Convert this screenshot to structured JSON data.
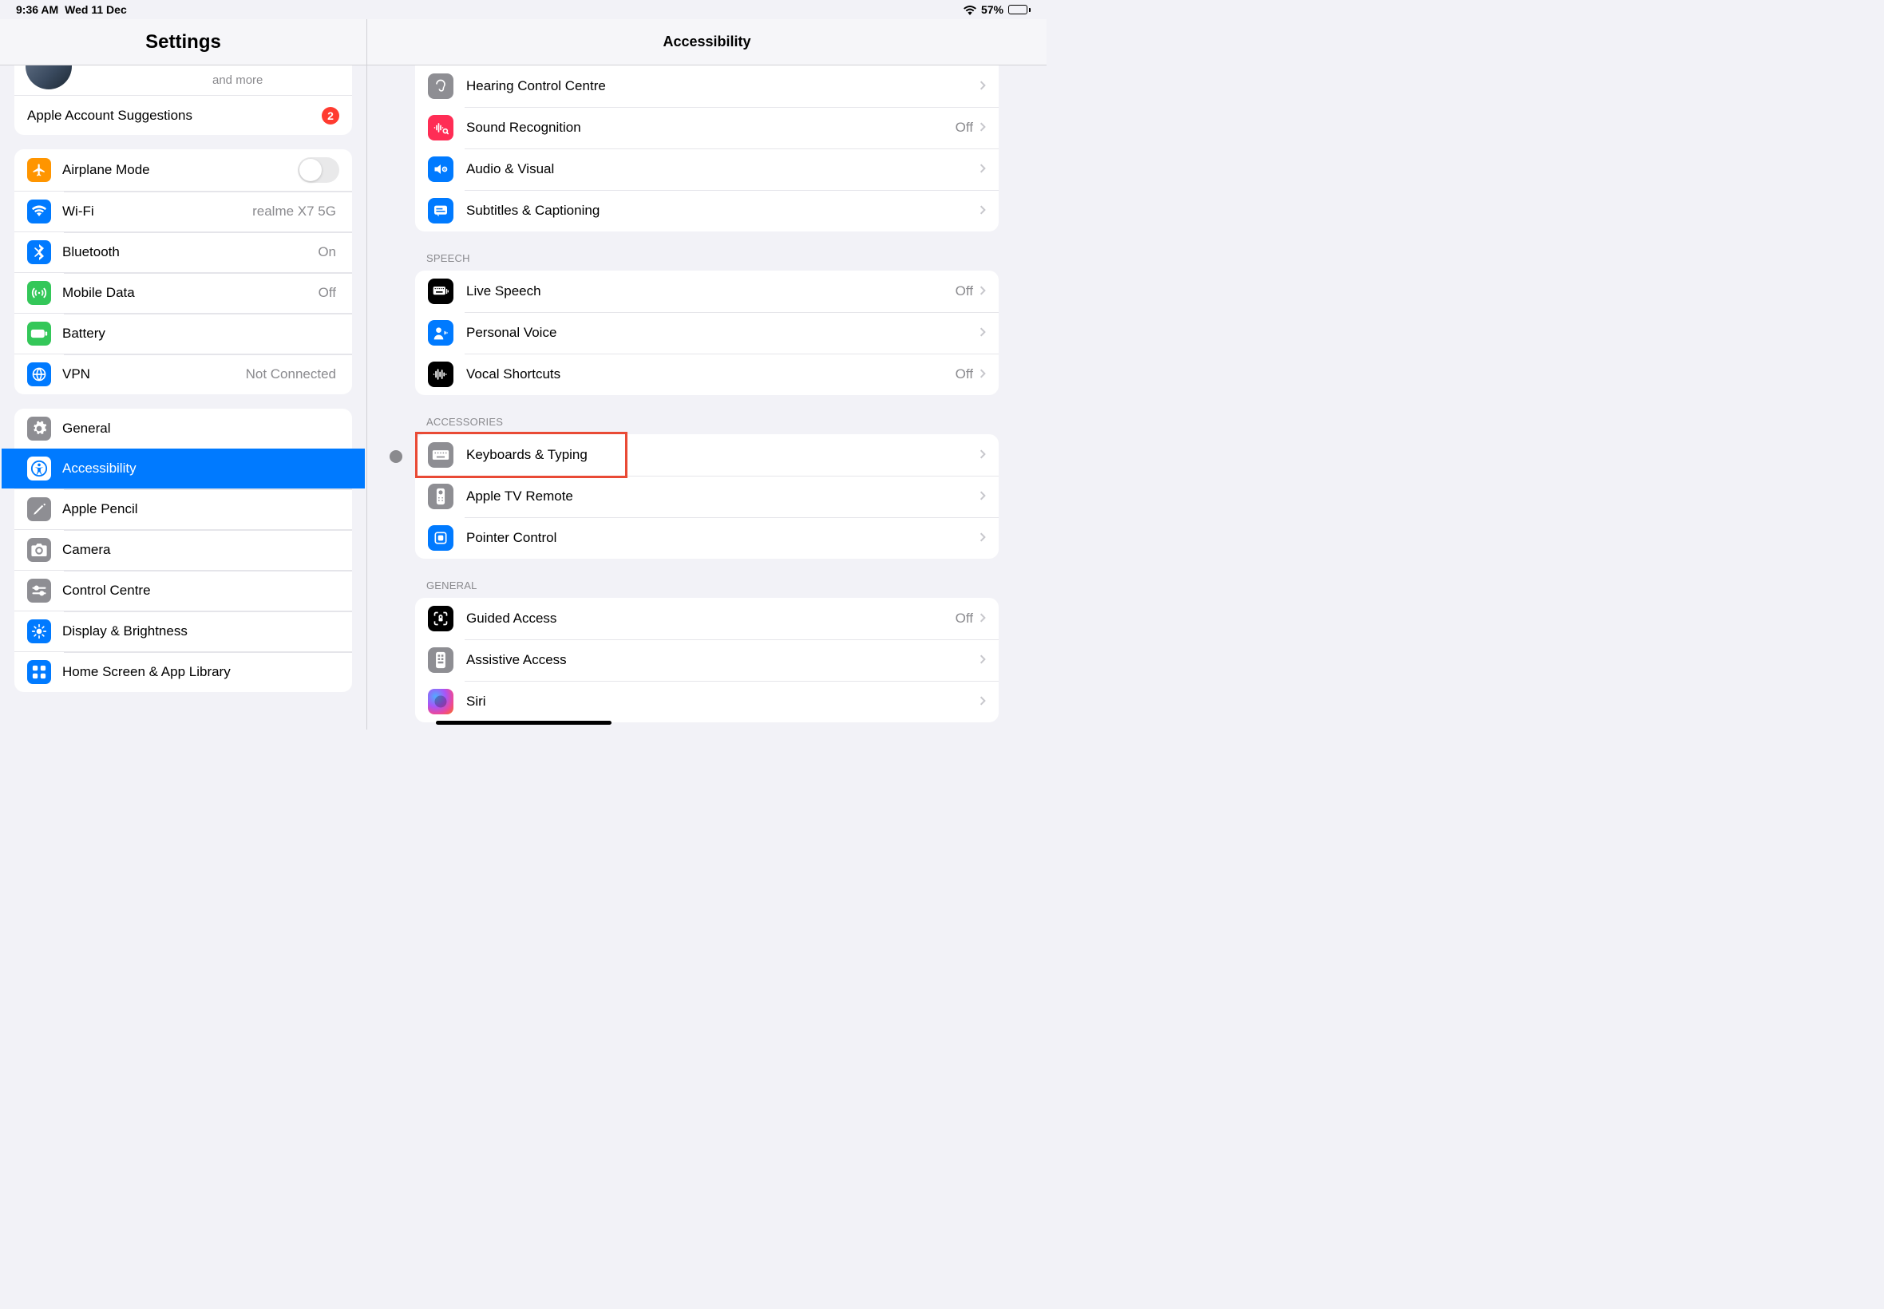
{
  "status": {
    "time": "9:36 AM",
    "date": "Wed 11 Dec",
    "battery": "57%"
  },
  "sidebar": {
    "title": "Settings",
    "profile_sub": "and more",
    "account_suggestions": "Apple Account Suggestions",
    "badge": "2",
    "conn": {
      "airplane": "Airplane Mode",
      "wifi": "Wi-Fi",
      "wifi_value": "realme X7 5G",
      "bt": "Bluetooth",
      "bt_value": "On",
      "mobile": "Mobile Data",
      "mobile_value": "Off",
      "battery": "Battery",
      "vpn": "VPN",
      "vpn_value": "Not Connected"
    },
    "main": {
      "general": "General",
      "accessibility": "Accessibility",
      "pencil": "Apple Pencil",
      "camera": "Camera",
      "control": "Control Centre",
      "display": "Display & Brightness",
      "home": "Home Screen & App Library"
    }
  },
  "content": {
    "title": "Accessibility",
    "hearing_partial": {
      "hcc": "Hearing Control Centre",
      "sound_rec": "Sound Recognition",
      "sound_rec_v": "Off",
      "av": "Audio & Visual",
      "subtitles": "Subtitles & Captioning"
    },
    "headers": {
      "speech": "SPEECH",
      "accessories": "ACCESSORIES",
      "general": "GENERAL"
    },
    "speech": {
      "live": "Live Speech",
      "live_v": "Off",
      "personal": "Personal Voice",
      "vocal": "Vocal Shortcuts",
      "vocal_v": "Off"
    },
    "accessories": {
      "keyboards": "Keyboards & Typing",
      "remote": "Apple TV Remote",
      "pointer": "Pointer Control"
    },
    "general": {
      "guided": "Guided Access",
      "guided_v": "Off",
      "assistive": "Assistive Access",
      "siri": "Siri"
    }
  }
}
